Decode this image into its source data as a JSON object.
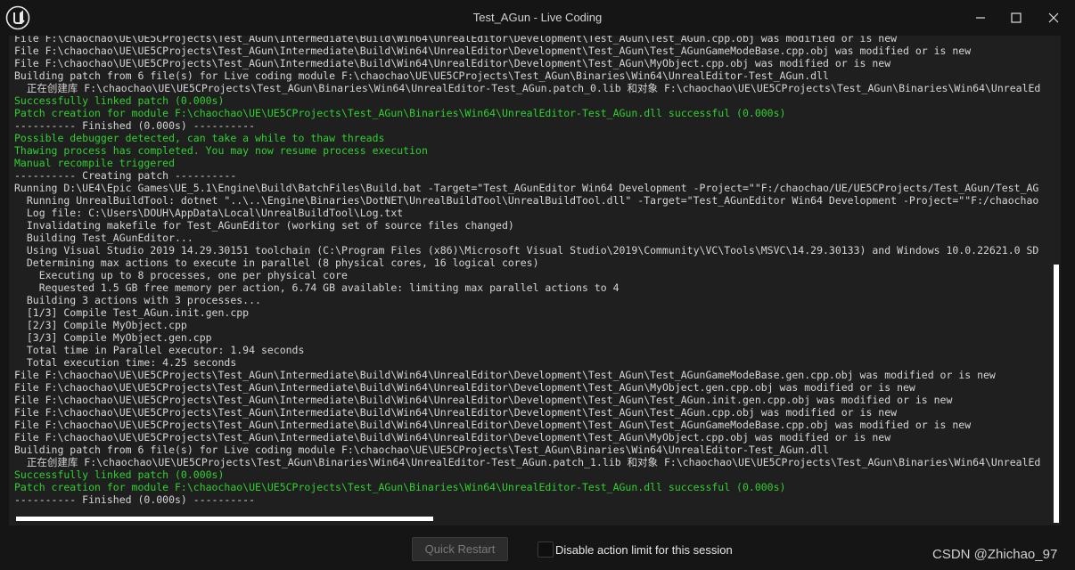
{
  "window": {
    "title": "Test_AGun - Live Coding",
    "minimize_icon": "minimize-icon",
    "maximize_icon": "maximize-icon",
    "close_icon": "close-icon",
    "logo_icon": "unreal-logo-icon"
  },
  "colors": {
    "normal_text": "#d6d6d6",
    "success_text": "#2fd12f",
    "background": "#151515",
    "console_background": "#1f1f1f"
  },
  "log": [
    {
      "text": "File F:\\chaochao\\UE\\UE5CProjects\\Test_AGun\\Intermediate\\Build\\Win64\\UnrealEditor\\Development\\Test_AGun\\Test_AGun.cpp.obj was modified or is new",
      "color": "normal"
    },
    {
      "text": "File F:\\chaochao\\UE\\UE5CProjects\\Test_AGun\\Intermediate\\Build\\Win64\\UnrealEditor\\Development\\Test_AGun\\Test_AGunGameModeBase.cpp.obj was modified or is new",
      "color": "normal"
    },
    {
      "text": "File F:\\chaochao\\UE\\UE5CProjects\\Test_AGun\\Intermediate\\Build\\Win64\\UnrealEditor\\Development\\Test_AGun\\MyObject.cpp.obj was modified or is new",
      "color": "normal"
    },
    {
      "text": "Building patch from 6 file(s) for Live coding module F:\\chaochao\\UE\\UE5CProjects\\Test_AGun\\Binaries\\Win64\\UnrealEditor-Test_AGun.dll",
      "color": "normal"
    },
    {
      "text": "  正在创建库 F:\\chaochao\\UE\\UE5CProjects\\Test_AGun\\Binaries\\Win64\\UnrealEditor-Test_AGun.patch_0.lib 和对象 F:\\chaochao\\UE\\UE5CProjects\\Test_AGun\\Binaries\\Win64\\UnrealEd",
      "color": "normal"
    },
    {
      "text": "Successfully linked patch (0.000s)",
      "color": "green"
    },
    {
      "text": "Patch creation for module F:\\chaochao\\UE\\UE5CProjects\\Test_AGun\\Binaries\\Win64\\UnrealEditor-Test_AGun.dll successful (0.000s)",
      "color": "green"
    },
    {
      "text": "---------- Finished (0.000s) ----------",
      "color": "normal"
    },
    {
      "text": "Possible debugger detected, can take a while to thaw threads",
      "color": "green"
    },
    {
      "text": "Thawing process has completed. You may now resume process execution",
      "color": "green"
    },
    {
      "text": "Manual recompile triggered",
      "color": "green"
    },
    {
      "text": "---------- Creating patch ----------",
      "color": "normal"
    },
    {
      "text": "Running D:\\UE4\\Epic Games\\UE_5.1\\Engine\\Build\\BatchFiles\\Build.bat -Target=\"Test_AGunEditor Win64 Development -Project=\"\"F:/chaochao/UE/UE5CProjects/Test_AGun/Test_AG",
      "color": "normal"
    },
    {
      "text": "  Running UnrealBuildTool: dotnet \"..\\..\\Engine\\Binaries\\DotNET\\UnrealBuildTool\\UnrealBuildTool.dll\" -Target=\"Test_AGunEditor Win64 Development -Project=\"\"F:/chaochao",
      "color": "normal"
    },
    {
      "text": "  Log file: C:\\Users\\DOUH\\AppData\\Local\\UnrealBuildTool\\Log.txt",
      "color": "normal"
    },
    {
      "text": "  Invalidating makefile for Test_AGunEditor (working set of source files changed)",
      "color": "normal"
    },
    {
      "text": "  Building Test_AGunEditor...",
      "color": "normal"
    },
    {
      "text": "  Using Visual Studio 2019 14.29.30151 toolchain (C:\\Program Files (x86)\\Microsoft Visual Studio\\2019\\Community\\VC\\Tools\\MSVC\\14.29.30133) and Windows 10.0.22621.0 SD",
      "color": "normal"
    },
    {
      "text": "  Determining max actions to execute in parallel (8 physical cores, 16 logical cores)",
      "color": "normal"
    },
    {
      "text": "    Executing up to 8 processes, one per physical core",
      "color": "normal"
    },
    {
      "text": "    Requested 1.5 GB free memory per action, 6.74 GB available: limiting max parallel actions to 4",
      "color": "normal"
    },
    {
      "text": "  Building 3 actions with 3 processes...",
      "color": "normal"
    },
    {
      "text": "  [1/3] Compile Test_AGun.init.gen.cpp",
      "color": "normal"
    },
    {
      "text": "  [2/3] Compile MyObject.cpp",
      "color": "normal"
    },
    {
      "text": "  [3/3] Compile MyObject.gen.cpp",
      "color": "normal"
    },
    {
      "text": "  Total time in Parallel executor: 1.94 seconds",
      "color": "normal"
    },
    {
      "text": "  Total execution time: 4.25 seconds",
      "color": "normal"
    },
    {
      "text": "File F:\\chaochao\\UE\\UE5CProjects\\Test_AGun\\Intermediate\\Build\\Win64\\UnrealEditor\\Development\\Test_AGun\\Test_AGunGameModeBase.gen.cpp.obj was modified or is new",
      "color": "normal"
    },
    {
      "text": "File F:\\chaochao\\UE\\UE5CProjects\\Test_AGun\\Intermediate\\Build\\Win64\\UnrealEditor\\Development\\Test_AGun\\MyObject.gen.cpp.obj was modified or is new",
      "color": "normal"
    },
    {
      "text": "File F:\\chaochao\\UE\\UE5CProjects\\Test_AGun\\Intermediate\\Build\\Win64\\UnrealEditor\\Development\\Test_AGun\\Test_AGun.init.gen.cpp.obj was modified or is new",
      "color": "normal"
    },
    {
      "text": "File F:\\chaochao\\UE\\UE5CProjects\\Test_AGun\\Intermediate\\Build\\Win64\\UnrealEditor\\Development\\Test_AGun\\Test_AGun.cpp.obj was modified or is new",
      "color": "normal"
    },
    {
      "text": "File F:\\chaochao\\UE\\UE5CProjects\\Test_AGun\\Intermediate\\Build\\Win64\\UnrealEditor\\Development\\Test_AGun\\Test_AGunGameModeBase.cpp.obj was modified or is new",
      "color": "normal"
    },
    {
      "text": "File F:\\chaochao\\UE\\UE5CProjects\\Test_AGun\\Intermediate\\Build\\Win64\\UnrealEditor\\Development\\Test_AGun\\MyObject.cpp.obj was modified or is new",
      "color": "normal"
    },
    {
      "text": "Building patch from 6 file(s) for Live coding module F:\\chaochao\\UE\\UE5CProjects\\Test_AGun\\Binaries\\Win64\\UnrealEditor-Test_AGun.dll",
      "color": "normal"
    },
    {
      "text": "  正在创建库 F:\\chaochao\\UE\\UE5CProjects\\Test_AGun\\Binaries\\Win64\\UnrealEditor-Test_AGun.patch_1.lib 和对象 F:\\chaochao\\UE\\UE5CProjects\\Test_AGun\\Binaries\\Win64\\UnrealEd",
      "color": "normal"
    },
    {
      "text": "Successfully linked patch (0.000s)",
      "color": "green"
    },
    {
      "text": "Patch creation for module F:\\chaochao\\UE\\UE5CProjects\\Test_AGun\\Binaries\\Win64\\UnrealEditor-Test_AGun.dll successful (0.000s)",
      "color": "green"
    },
    {
      "text": "---------- Finished (0.000s) ----------",
      "color": "normal"
    }
  ],
  "footer": {
    "quick_restart_label": "Quick Restart",
    "checkbox_label": "Disable action limit for this session",
    "checkbox_checked": false,
    "watermark": "CSDN @Zhichao_97"
  }
}
